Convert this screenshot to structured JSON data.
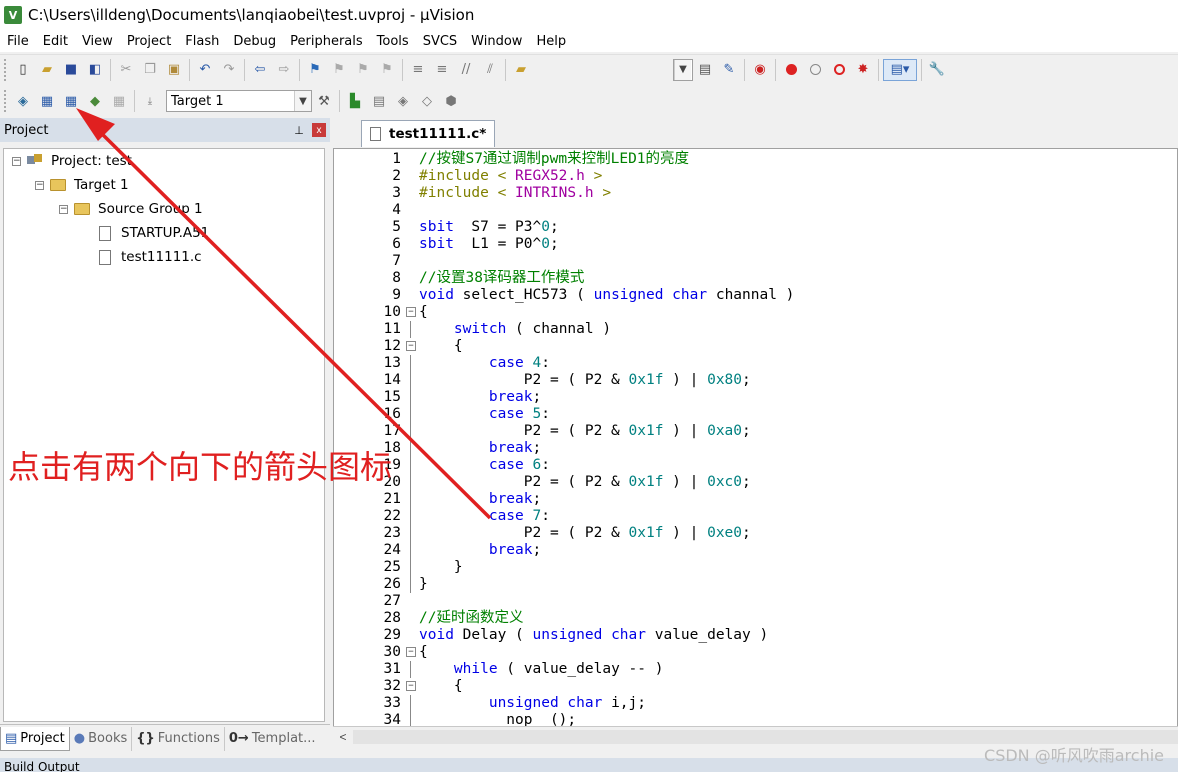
{
  "window": {
    "app_icon_text": "V",
    "title": "C:\\Users\\illdeng\\Documents\\lanqiaobei\\test.uvproj - µVision"
  },
  "menu": [
    "File",
    "Edit",
    "View",
    "Project",
    "Flash",
    "Debug",
    "Peripherals",
    "Tools",
    "SVCS",
    "Window",
    "Help"
  ],
  "toolbar2": {
    "target_value": "Target 1"
  },
  "project_panel": {
    "title": "Project",
    "pin_glyph": "⊥",
    "close_glyph": "x",
    "tree": {
      "project": "Project: test",
      "target": "Target 1",
      "group": "Source Group 1",
      "files": [
        "STARTUP.A51",
        "test11111.c"
      ]
    },
    "bottom_tabs": [
      {
        "icon": "▤",
        "label": "Project"
      },
      {
        "icon": "●",
        "label": "Books"
      },
      {
        "icon": "{}",
        "label": "Functions"
      },
      {
        "icon": "0→",
        "label": "Templat..."
      }
    ]
  },
  "editor": {
    "tab_label": "test11111.c*",
    "lines": [
      {
        "n": "1",
        "fold": "",
        "segs": [
          [
            "c-com",
            "//按键S7通过调制pwm来控制LED1的亮度"
          ]
        ]
      },
      {
        "n": "2",
        "fold": "",
        "segs": [
          [
            "c-pre",
            "#include < "
          ],
          [
            "c-str",
            "REGX52.h"
          ],
          [
            "c-pre",
            " >"
          ]
        ]
      },
      {
        "n": "3",
        "fold": "",
        "segs": [
          [
            "c-pre",
            "#include < "
          ],
          [
            "c-str",
            "INTRINS.h"
          ],
          [
            "c-pre",
            " >"
          ]
        ]
      },
      {
        "n": "4",
        "fold": "",
        "segs": []
      },
      {
        "n": "5",
        "fold": "",
        "segs": [
          [
            "c-kw",
            "sbit"
          ],
          [
            "",
            "  S7 = P3^"
          ],
          [
            "c-num",
            "0"
          ],
          [
            "",
            ";"
          ]
        ]
      },
      {
        "n": "6",
        "fold": "",
        "segs": [
          [
            "c-kw",
            "sbit"
          ],
          [
            "",
            "  L1 = P0^"
          ],
          [
            "c-num",
            "0"
          ],
          [
            "",
            ";"
          ]
        ]
      },
      {
        "n": "7",
        "fold": "",
        "segs": []
      },
      {
        "n": "8",
        "fold": "",
        "segs": [
          [
            "c-com",
            "//设置38译码器工作模式"
          ]
        ]
      },
      {
        "n": "9",
        "fold": "",
        "segs": [
          [
            "c-kw",
            "void"
          ],
          [
            "",
            " select_HC573 ( "
          ],
          [
            "c-kw",
            "unsigned char"
          ],
          [
            "",
            " channal )"
          ]
        ]
      },
      {
        "n": "10",
        "fold": "box",
        "segs": [
          [
            "",
            "{"
          ]
        ]
      },
      {
        "n": "11",
        "fold": "line",
        "segs": [
          [
            "",
            "    "
          ],
          [
            "c-kw",
            "switch"
          ],
          [
            "",
            " ( channal )"
          ]
        ]
      },
      {
        "n": "12",
        "fold": "box",
        "segs": [
          [
            "",
            "    {"
          ]
        ]
      },
      {
        "n": "13",
        "fold": "line",
        "segs": [
          [
            "",
            "        "
          ],
          [
            "c-kw",
            "case"
          ],
          [
            "",
            " "
          ],
          [
            "c-num",
            "4"
          ],
          [
            "",
            ":"
          ]
        ]
      },
      {
        "n": "14",
        "fold": "line",
        "segs": [
          [
            "",
            "            P2 = ( P2 & "
          ],
          [
            "c-num",
            "0x1f"
          ],
          [
            "",
            " ) | "
          ],
          [
            "c-num",
            "0x80"
          ],
          [
            "",
            ";"
          ]
        ]
      },
      {
        "n": "15",
        "fold": "line",
        "segs": [
          [
            "",
            "        "
          ],
          [
            "c-kw",
            "break"
          ],
          [
            "",
            ";"
          ]
        ]
      },
      {
        "n": "16",
        "fold": "line",
        "segs": [
          [
            "",
            "        "
          ],
          [
            "c-kw",
            "case"
          ],
          [
            "",
            " "
          ],
          [
            "c-num",
            "5"
          ],
          [
            "",
            ":"
          ]
        ]
      },
      {
        "n": "17",
        "fold": "line",
        "segs": [
          [
            "",
            "            P2 = ( P2 & "
          ],
          [
            "c-num",
            "0x1f"
          ],
          [
            "",
            " ) | "
          ],
          [
            "c-num",
            "0xa0"
          ],
          [
            "",
            ";"
          ]
        ]
      },
      {
        "n": "18",
        "fold": "line",
        "segs": [
          [
            "",
            "        "
          ],
          [
            "c-kw",
            "break"
          ],
          [
            "",
            ";"
          ]
        ]
      },
      {
        "n": "19",
        "fold": "line",
        "segs": [
          [
            "",
            "        "
          ],
          [
            "c-kw",
            "case"
          ],
          [
            "",
            " "
          ],
          [
            "c-num",
            "6"
          ],
          [
            "",
            ":"
          ]
        ]
      },
      {
        "n": "20",
        "fold": "line",
        "segs": [
          [
            "",
            "            P2 = ( P2 & "
          ],
          [
            "c-num",
            "0x1f"
          ],
          [
            "",
            " ) | "
          ],
          [
            "c-num",
            "0xc0"
          ],
          [
            "",
            ";"
          ]
        ]
      },
      {
        "n": "21",
        "fold": "line",
        "segs": [
          [
            "",
            "        "
          ],
          [
            "c-kw",
            "break"
          ],
          [
            "",
            ";"
          ]
        ]
      },
      {
        "n": "22",
        "fold": "line",
        "segs": [
          [
            "",
            "        "
          ],
          [
            "c-kw",
            "case"
          ],
          [
            "",
            " "
          ],
          [
            "c-num",
            "7"
          ],
          [
            "",
            ":"
          ]
        ]
      },
      {
        "n": "23",
        "fold": "line",
        "segs": [
          [
            "",
            "            P2 = ( P2 & "
          ],
          [
            "c-num",
            "0x1f"
          ],
          [
            "",
            " ) | "
          ],
          [
            "c-num",
            "0xe0"
          ],
          [
            "",
            ";"
          ]
        ]
      },
      {
        "n": "24",
        "fold": "line",
        "segs": [
          [
            "",
            "        "
          ],
          [
            "c-kw",
            "break"
          ],
          [
            "",
            ";"
          ]
        ]
      },
      {
        "n": "25",
        "fold": "line",
        "segs": [
          [
            "",
            "    }"
          ]
        ]
      },
      {
        "n": "26",
        "fold": "line",
        "segs": [
          [
            "",
            "}"
          ]
        ]
      },
      {
        "n": "27",
        "fold": "",
        "segs": []
      },
      {
        "n": "28",
        "fold": "",
        "segs": [
          [
            "c-com",
            "//延时函数定义"
          ]
        ]
      },
      {
        "n": "29",
        "fold": "",
        "segs": [
          [
            "c-kw",
            "void"
          ],
          [
            "",
            " Delay ( "
          ],
          [
            "c-kw",
            "unsigned char"
          ],
          [
            "",
            " value_delay )"
          ]
        ]
      },
      {
        "n": "30",
        "fold": "box",
        "segs": [
          [
            "",
            "{"
          ]
        ]
      },
      {
        "n": "31",
        "fold": "line",
        "segs": [
          [
            "",
            "    "
          ],
          [
            "c-kw",
            "while"
          ],
          [
            "",
            " ( value_delay -- )"
          ]
        ]
      },
      {
        "n": "32",
        "fold": "box",
        "segs": [
          [
            "",
            "    {"
          ]
        ]
      },
      {
        "n": "33",
        "fold": "line",
        "segs": [
          [
            "",
            "        "
          ],
          [
            "c-kw",
            "unsigned char"
          ],
          [
            "",
            " i,j;"
          ]
        ]
      },
      {
        "n": "34",
        "fold": "line",
        "segs": [
          [
            "",
            "         _nop_ ();"
          ]
        ]
      }
    ]
  },
  "scroll_left_glyph": "<",
  "status": {
    "build_output": "Build Output"
  },
  "annotation": "点击有两个向下的箭头图标",
  "watermark": "CSDN @听风吹雨archie",
  "colors": {
    "annotation": "#e02020",
    "arrow": "#e02020",
    "keyword": "#0000e6",
    "comment": "#008000"
  }
}
